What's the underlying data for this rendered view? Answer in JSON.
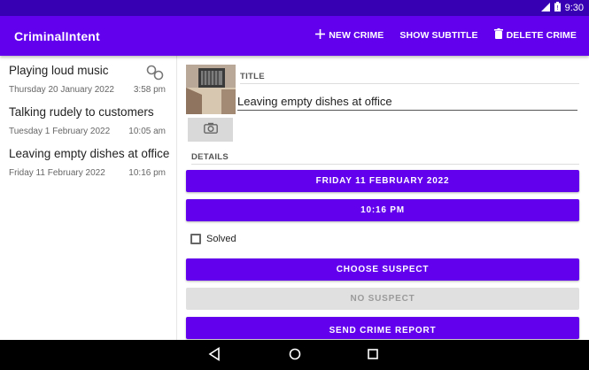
{
  "status_bar": {
    "time": "9:30",
    "icons": [
      "signal-icon",
      "battery-icon"
    ]
  },
  "app_bar": {
    "title": "CriminalIntent",
    "new_crime": "NEW CRIME",
    "show_subtitle": "SHOW SUBTITLE",
    "delete_crime": "DELETE CRIME"
  },
  "crimes": [
    {
      "title": "Playing loud music",
      "date": "Thursday 20 January 2022",
      "time": "3:58 pm",
      "solved": true
    },
    {
      "title": "Talking rudely to customers",
      "date": "Tuesday 1 February 2022",
      "time": "10:05 am",
      "solved": false
    },
    {
      "title": "Leaving empty dishes at office",
      "date": "Friday 11 February 2022",
      "time": "10:16 pm",
      "solved": false
    }
  ],
  "detail": {
    "title_label": "TITLE",
    "title_value": "Leaving empty dishes at office",
    "details_label": "DETAILS",
    "date_button": "FRIDAY 11 FEBRUARY 2022",
    "time_button": "10:16 PM",
    "solved_label": "Solved",
    "solved_checked": false,
    "choose_suspect": "CHOOSE SUSPECT",
    "no_suspect": "NO SUSPECT",
    "send_report": "SEND CRIME REPORT"
  },
  "colors": {
    "primary": "#6200ee",
    "primary_dark": "#3700b3",
    "disabled": "#e0e0e0"
  }
}
